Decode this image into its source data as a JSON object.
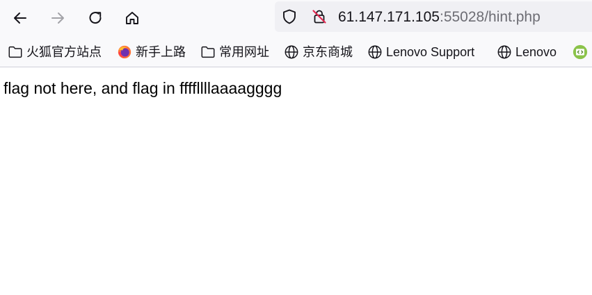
{
  "toolbar": {
    "back_icon": "arrow-left-icon",
    "forward_icon": "arrow-right-icon",
    "reload_icon": "reload-icon",
    "home_icon": "home-icon"
  },
  "urlbar": {
    "shield_icon": "shield-icon",
    "insecure_icon": "insecure-lock-icon",
    "host": "61.147.171.105",
    "port_path": ":55028/hint.php"
  },
  "bookmarks": [
    {
      "label": "火狐官方站点",
      "icon": "folder-icon"
    },
    {
      "label": "新手上路",
      "icon": "firefox-icon"
    },
    {
      "label": "常用网址",
      "icon": "folder-icon"
    },
    {
      "label": "京东商城",
      "icon": "globe-icon"
    },
    {
      "label": "Lenovo Support",
      "icon": "globe-icon"
    },
    {
      "label": "Lenovo",
      "icon": "globe-icon"
    },
    {
      "label": "",
      "icon": "code-badge-icon"
    }
  ],
  "page": {
    "body_text": "flag not here, and flag in ffffllllaaaagggg"
  },
  "colors": {
    "toolbar_bg": "#f9f9fb",
    "urlbar_bg": "#f0f0f4",
    "text": "#15141a",
    "dim_text": "#6d6d74",
    "insecure_red": "#e22850"
  }
}
